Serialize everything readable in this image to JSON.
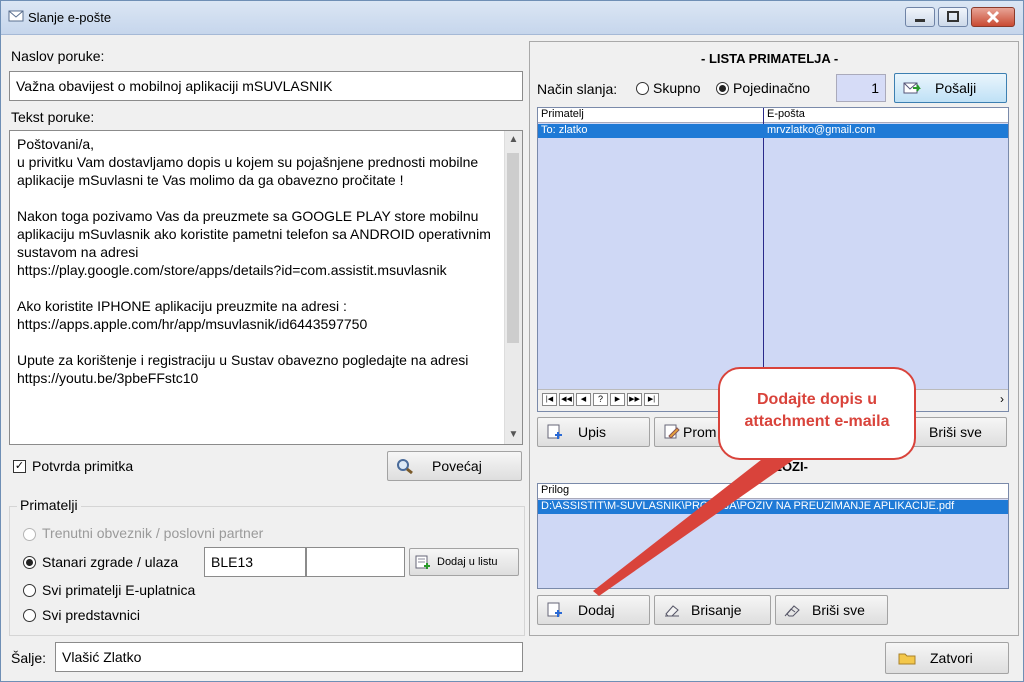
{
  "window": {
    "title": "Slanje e-pošte"
  },
  "left": {
    "subject_label": "Naslov poruke:",
    "subject_value": "Važna obavijest o mobilnoj aplikaciji mSUVLASNIK",
    "body_label": "Tekst poruke:",
    "body_text": "Poštovani/a,\nu privitku Vam dostavljamo dopis u kojem su pojašnjene prednosti mobilne aplikacije mSuvlasni te Vas molimo da ga obavezno pročitate !\n\nNakon toga pozivamo Vas da preuzmete sa GOOGLE PLAY store mobilnu aplikaciju mSuvlasnik ako koristite pametni telefon sa ANDROID operativnim sustavom na adresi\nhttps://play.google.com/store/apps/details?id=com.assistit.msuvlasnik\n\nAko koristite IPHONE aplikaciju preuzmite na adresi :\nhttps://apps.apple.com/hr/app/msuvlasnik/id6443597750\n\nUpute za korištenje i registraciju u Sustav obavezno pogledajte na adresi\nhttps://youtu.be/3pbeFFstc10",
    "receipt_label": "Potvrda primitka",
    "zoom_button": "Povećaj",
    "recipients_group": "Primatelji",
    "option_current": "Trenutni obveznik / poslovni partner",
    "option_tenants": "Stanari zgrade / ulaza",
    "building_code": "BLE13",
    "building_extra": "",
    "add_to_list_button": "Dodaj u listu",
    "option_all_eupl": "Svi primatelji E-uplatnica",
    "option_representatives": "Svi predstavnici",
    "sender_label": "Šalje:",
    "sender_value": "Vlašić Zlatko"
  },
  "right": {
    "list_title": "- LISTA PRIMATELJA -",
    "send_mode_label": "Način slanja:",
    "mode_group": "Skupno",
    "mode_individual": "Pojedinačno",
    "count": "1",
    "send_button": "Pošalji",
    "grid_col1": "Primatelj",
    "grid_col2": "E-pošta",
    "row1_recipient": "To:  zlatko",
    "row1_email": "mrvzlatko@gmail.com",
    "entry_button": "Upis",
    "change_button": "Prom",
    "delete_all_button": "Briši sve",
    "attachments_title": "RILOZI-",
    "attach_col": "Prilog",
    "attach_path": "D:\\ASSISTIT\\M-SUVLASNIK\\PRODAJA\\POZIV NA PREUZIMANJE APLIKACIJE.pdf",
    "add_button": "Dodaj",
    "remove_button": "Brisanje",
    "remove_all_button": "Briši sve",
    "close_button": "Zatvori"
  },
  "callout": {
    "line1": "Dodajte dopis u",
    "line2": "attachment e-maila"
  },
  "colors": {
    "selection": "#1f7ad6",
    "grid_bg": "#cfd8f5",
    "callout": "#d9433b"
  }
}
